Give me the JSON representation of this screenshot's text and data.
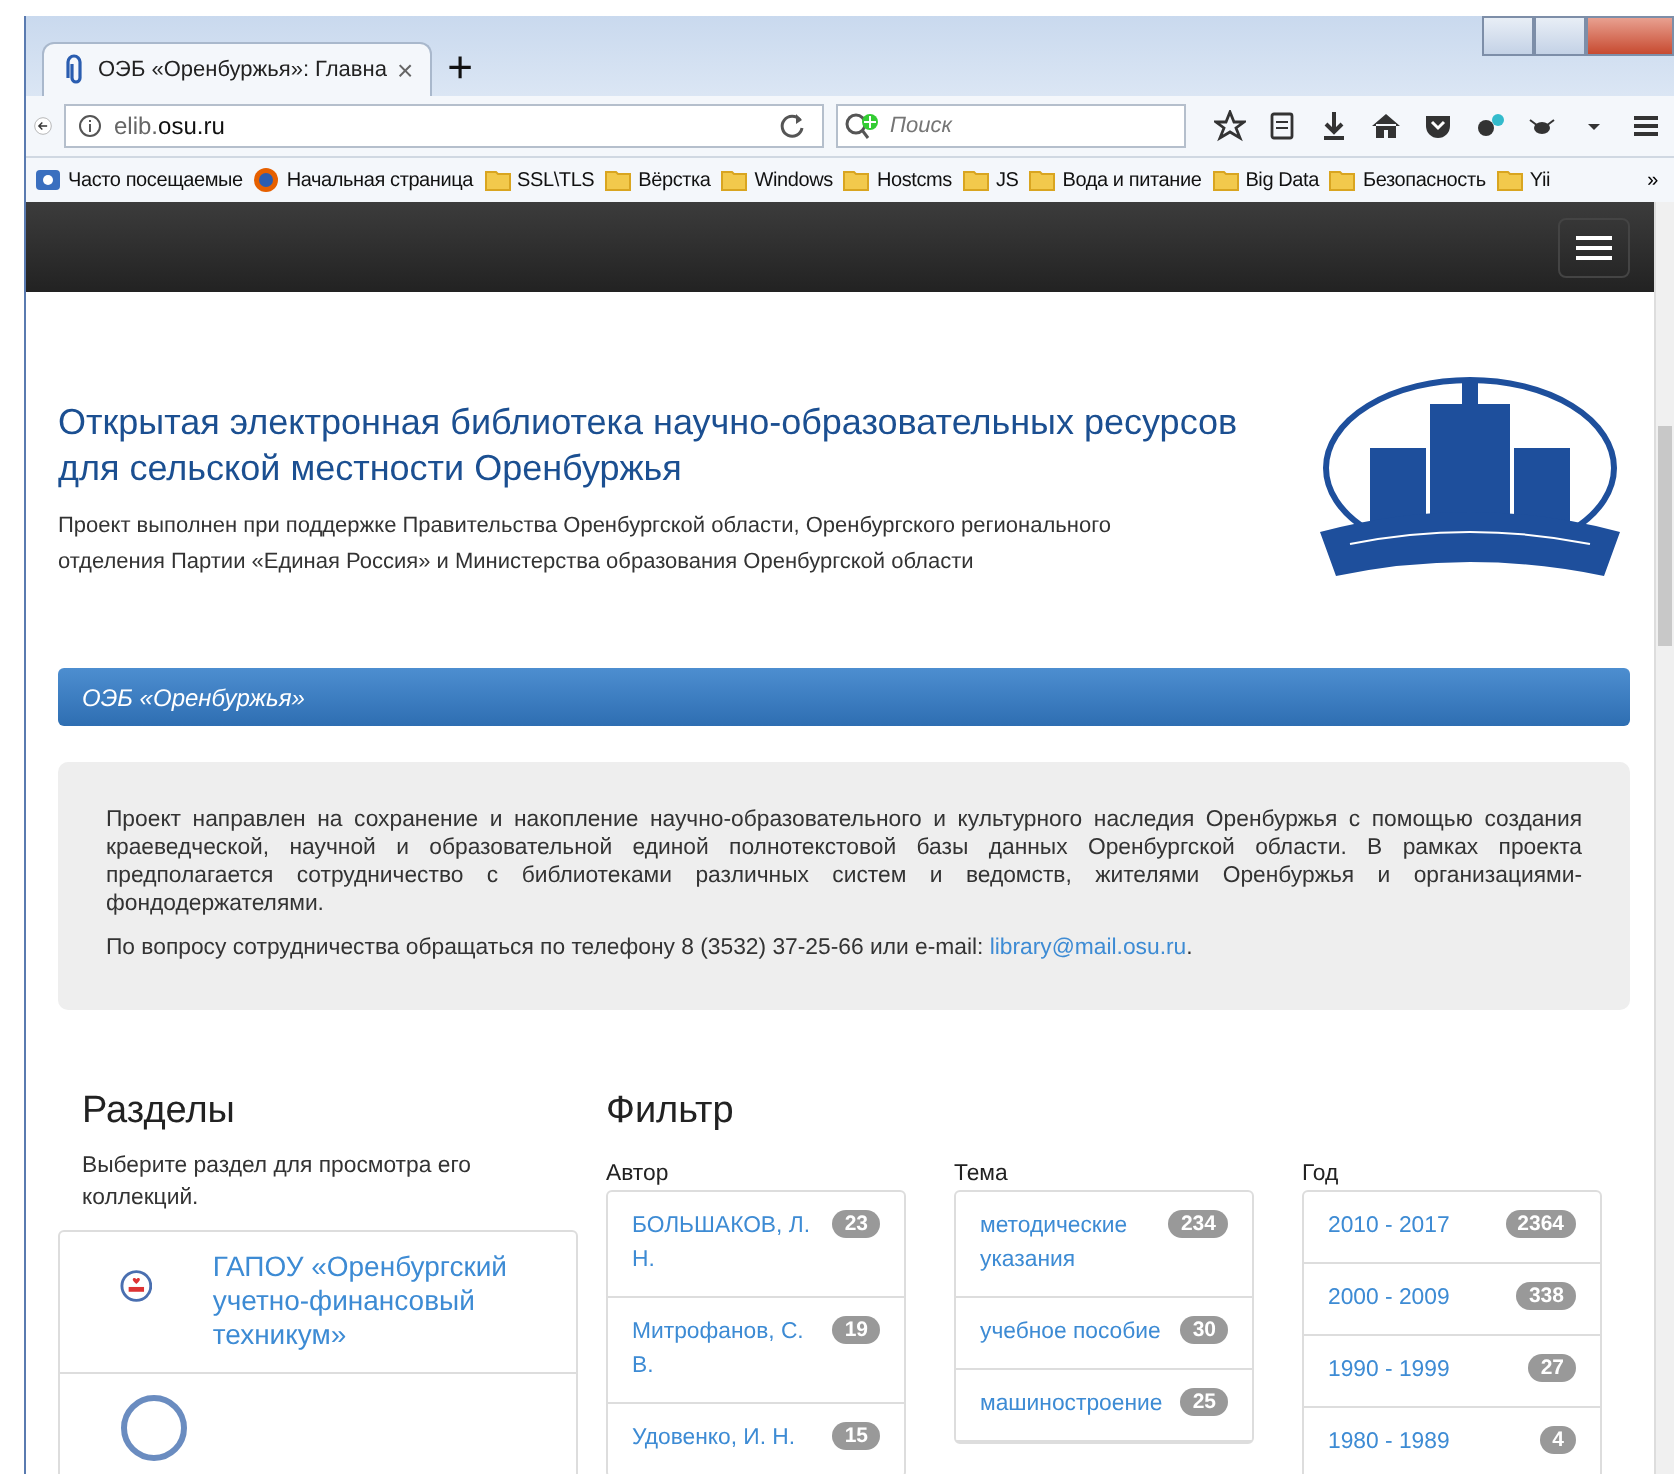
{
  "browser": {
    "tab_title": "ОЭБ «Оренбуржья»: Главна",
    "tab_close": "×",
    "new_tab": "+",
    "url_host": "elib.",
    "url_domain": "osu.ru",
    "search_placeholder": "Поиск",
    "bookmarks": [
      {
        "label": "Часто посещаемые",
        "kind": "special"
      },
      {
        "label": "Начальная страница",
        "kind": "browser"
      },
      {
        "label": "SSL\\TLS",
        "kind": "folder"
      },
      {
        "label": "Вёрстка",
        "kind": "folder"
      },
      {
        "label": "Windows",
        "kind": "folder"
      },
      {
        "label": "Hostcms",
        "kind": "folder"
      },
      {
        "label": "JS",
        "kind": "folder"
      },
      {
        "label": "Вода и питание",
        "kind": "folder"
      },
      {
        "label": "Big Data",
        "kind": "folder"
      },
      {
        "label": "Безопасность",
        "kind": "folder"
      },
      {
        "label": "Yii",
        "kind": "folder"
      }
    ],
    "more": "»"
  },
  "header": {
    "title": "Открытая электронная библиотека научно-образовательных ресурсов для сельской местности Оренбуржья",
    "subtitle": "Проект выполнен при поддержке Правительства Оренбургской области, Оренбургского регионального отделения Партии «Единая Россия» и Министерства образования Оренбургской области"
  },
  "breadcrumb": "ОЭБ «Оренбуржья»",
  "about": {
    "text": "Проект направлен на сохранение и накопление научно-образовательного и культурного наследия Оренбуржья с помощью создания краеведческой, научной и образовательной единой полнотекстовой базы данных Оренбургской области. В рамках проекта предполагается сотрудничество с библиотеками различных систем и ведомств, жителями Оренбуржья и организациями-фондодержателями.",
    "contact": "По вопросу сотрудничества обращаться по телефону 8 (3532) 37-25-66 или e-mail: ",
    "email": "library@mail.osu.ru",
    "end": "."
  },
  "sections": {
    "title": "Разделы",
    "hint": "Выберите раздел для просмотра его коллекций.",
    "items": [
      {
        "title": "ГАПОУ «Оренбургский учетно-финансовый техникум»"
      }
    ]
  },
  "filter": {
    "title": "Фильтр",
    "groups": [
      {
        "label": "Автор",
        "items": [
          {
            "text": "БОЛЬШАКОВ, Л. Н.",
            "count": "23"
          },
          {
            "text": "Митрофанов, С. В.",
            "count": "19"
          },
          {
            "text": "Удовенко, И. Н.",
            "count": "15"
          }
        ]
      },
      {
        "label": "Тема",
        "items": [
          {
            "text": "методические указания",
            "count": "234"
          },
          {
            "text": "учебное пособие",
            "count": "30"
          },
          {
            "text": "машиностроение",
            "count": "25"
          }
        ]
      },
      {
        "label": "Год",
        "items": [
          {
            "text": "2010 - 2017",
            "count": "2364"
          },
          {
            "text": "2000 - 2009",
            "count": "338"
          },
          {
            "text": "1990 - 1999",
            "count": "27"
          },
          {
            "text": "1980 - 1989",
            "count": "4"
          }
        ]
      }
    ]
  }
}
